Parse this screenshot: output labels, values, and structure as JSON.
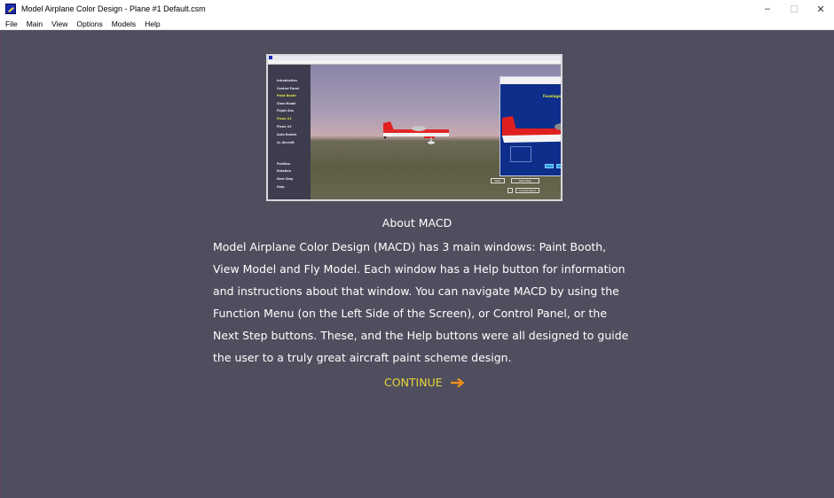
{
  "window": {
    "title": "Model Airplane Color Design - Plane #1  Default.csm",
    "controls": {
      "minimize": "–",
      "maximize": "☐",
      "close": "✕"
    }
  },
  "menubar": {
    "items": [
      "File",
      "Main",
      "View",
      "Options",
      "Models",
      "Help"
    ]
  },
  "preview": {
    "sidebar_items": [
      {
        "label": "Introduction",
        "active": false
      },
      {
        "label": "Control Panel",
        "active": false
      },
      {
        "label": "Paint Booth",
        "active": true
      },
      {
        "label": "View Model",
        "active": false
      },
      {
        "label": "Flight Sim",
        "active": false
      },
      {
        "label": "Plane #1",
        "active": true
      },
      {
        "label": "Plane #2",
        "active": false
      },
      {
        "label": "Auto Rotate",
        "active": false
      },
      {
        "label": "2x Aircraft",
        "active": false
      },
      {
        "label": "Position",
        "active": false
      },
      {
        "label": "Rotation",
        "active": false
      },
      {
        "label": "Next Step",
        "active": false
      },
      {
        "label": "Help",
        "active": false
      }
    ],
    "dialog_title": "Fuselage",
    "help_button": "Help",
    "next_step_button": "Next Step",
    "control_panel_button": "Control Panel"
  },
  "about": {
    "title": "About MACD",
    "lines": [
      "Model Airplane Color Design (MACD) has 3 main windows: Paint Booth,",
      "View Model and Fly Model. Each window has a Help button for information",
      "and instructions about that window. You can navigate MACD by using the",
      "Function Menu (on the Left Side of the Screen), or Control Panel, or the",
      "Next Step buttons. These, and the Help buttons were all designed to guide",
      "the user to a truly great aircraft paint scheme design."
    ]
  },
  "continue": {
    "label": "CONTINUE",
    "icon": "arrow-right-icon",
    "label_color": "#e8d838",
    "arrow_color": "#f0901c"
  },
  "colors": {
    "background": "#4f4e5e",
    "text": "#ffffff"
  }
}
